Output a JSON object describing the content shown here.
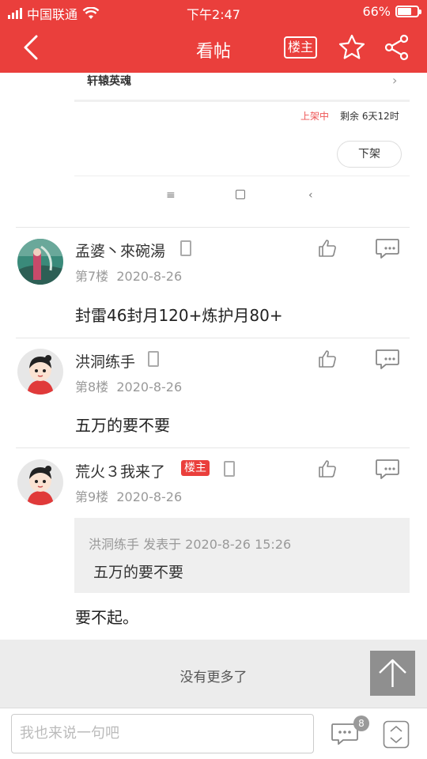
{
  "status_bar": {
    "carrier": "中国联通",
    "time": "下午2:47",
    "battery_text": "66%",
    "battery_level": 0.66
  },
  "header": {
    "title": "看帖",
    "lz_label": "楼主"
  },
  "embedded": {
    "item_label": "轩辕英魂",
    "status_on_shelf": "上架中",
    "status_remaining": "剩余 6天12时",
    "unshelve_button": "下架"
  },
  "posts": [
    {
      "author": "孟婆丶來碗湯",
      "floor": "第7楼",
      "date": "2020-8-26",
      "content": "封雷46封月120+炼护月80+"
    },
    {
      "author": "洪洞练手",
      "floor": "第8楼",
      "date": "2020-8-26",
      "content": "五万的要不要"
    },
    {
      "author": "荒火３我来了",
      "badge": "楼主",
      "floor": "第9楼",
      "date": "2020-8-26",
      "quote_header": "洪洞练手 发表于 2020-8-26 15:26",
      "quote_body": "五万的要不要",
      "content": "要不起。"
    }
  ],
  "footer": {
    "end_text": "没有更多了",
    "input_placeholder": "我也来说一句吧",
    "comment_count": "8"
  },
  "colors": {
    "brand_red": "#ea3f3c"
  }
}
